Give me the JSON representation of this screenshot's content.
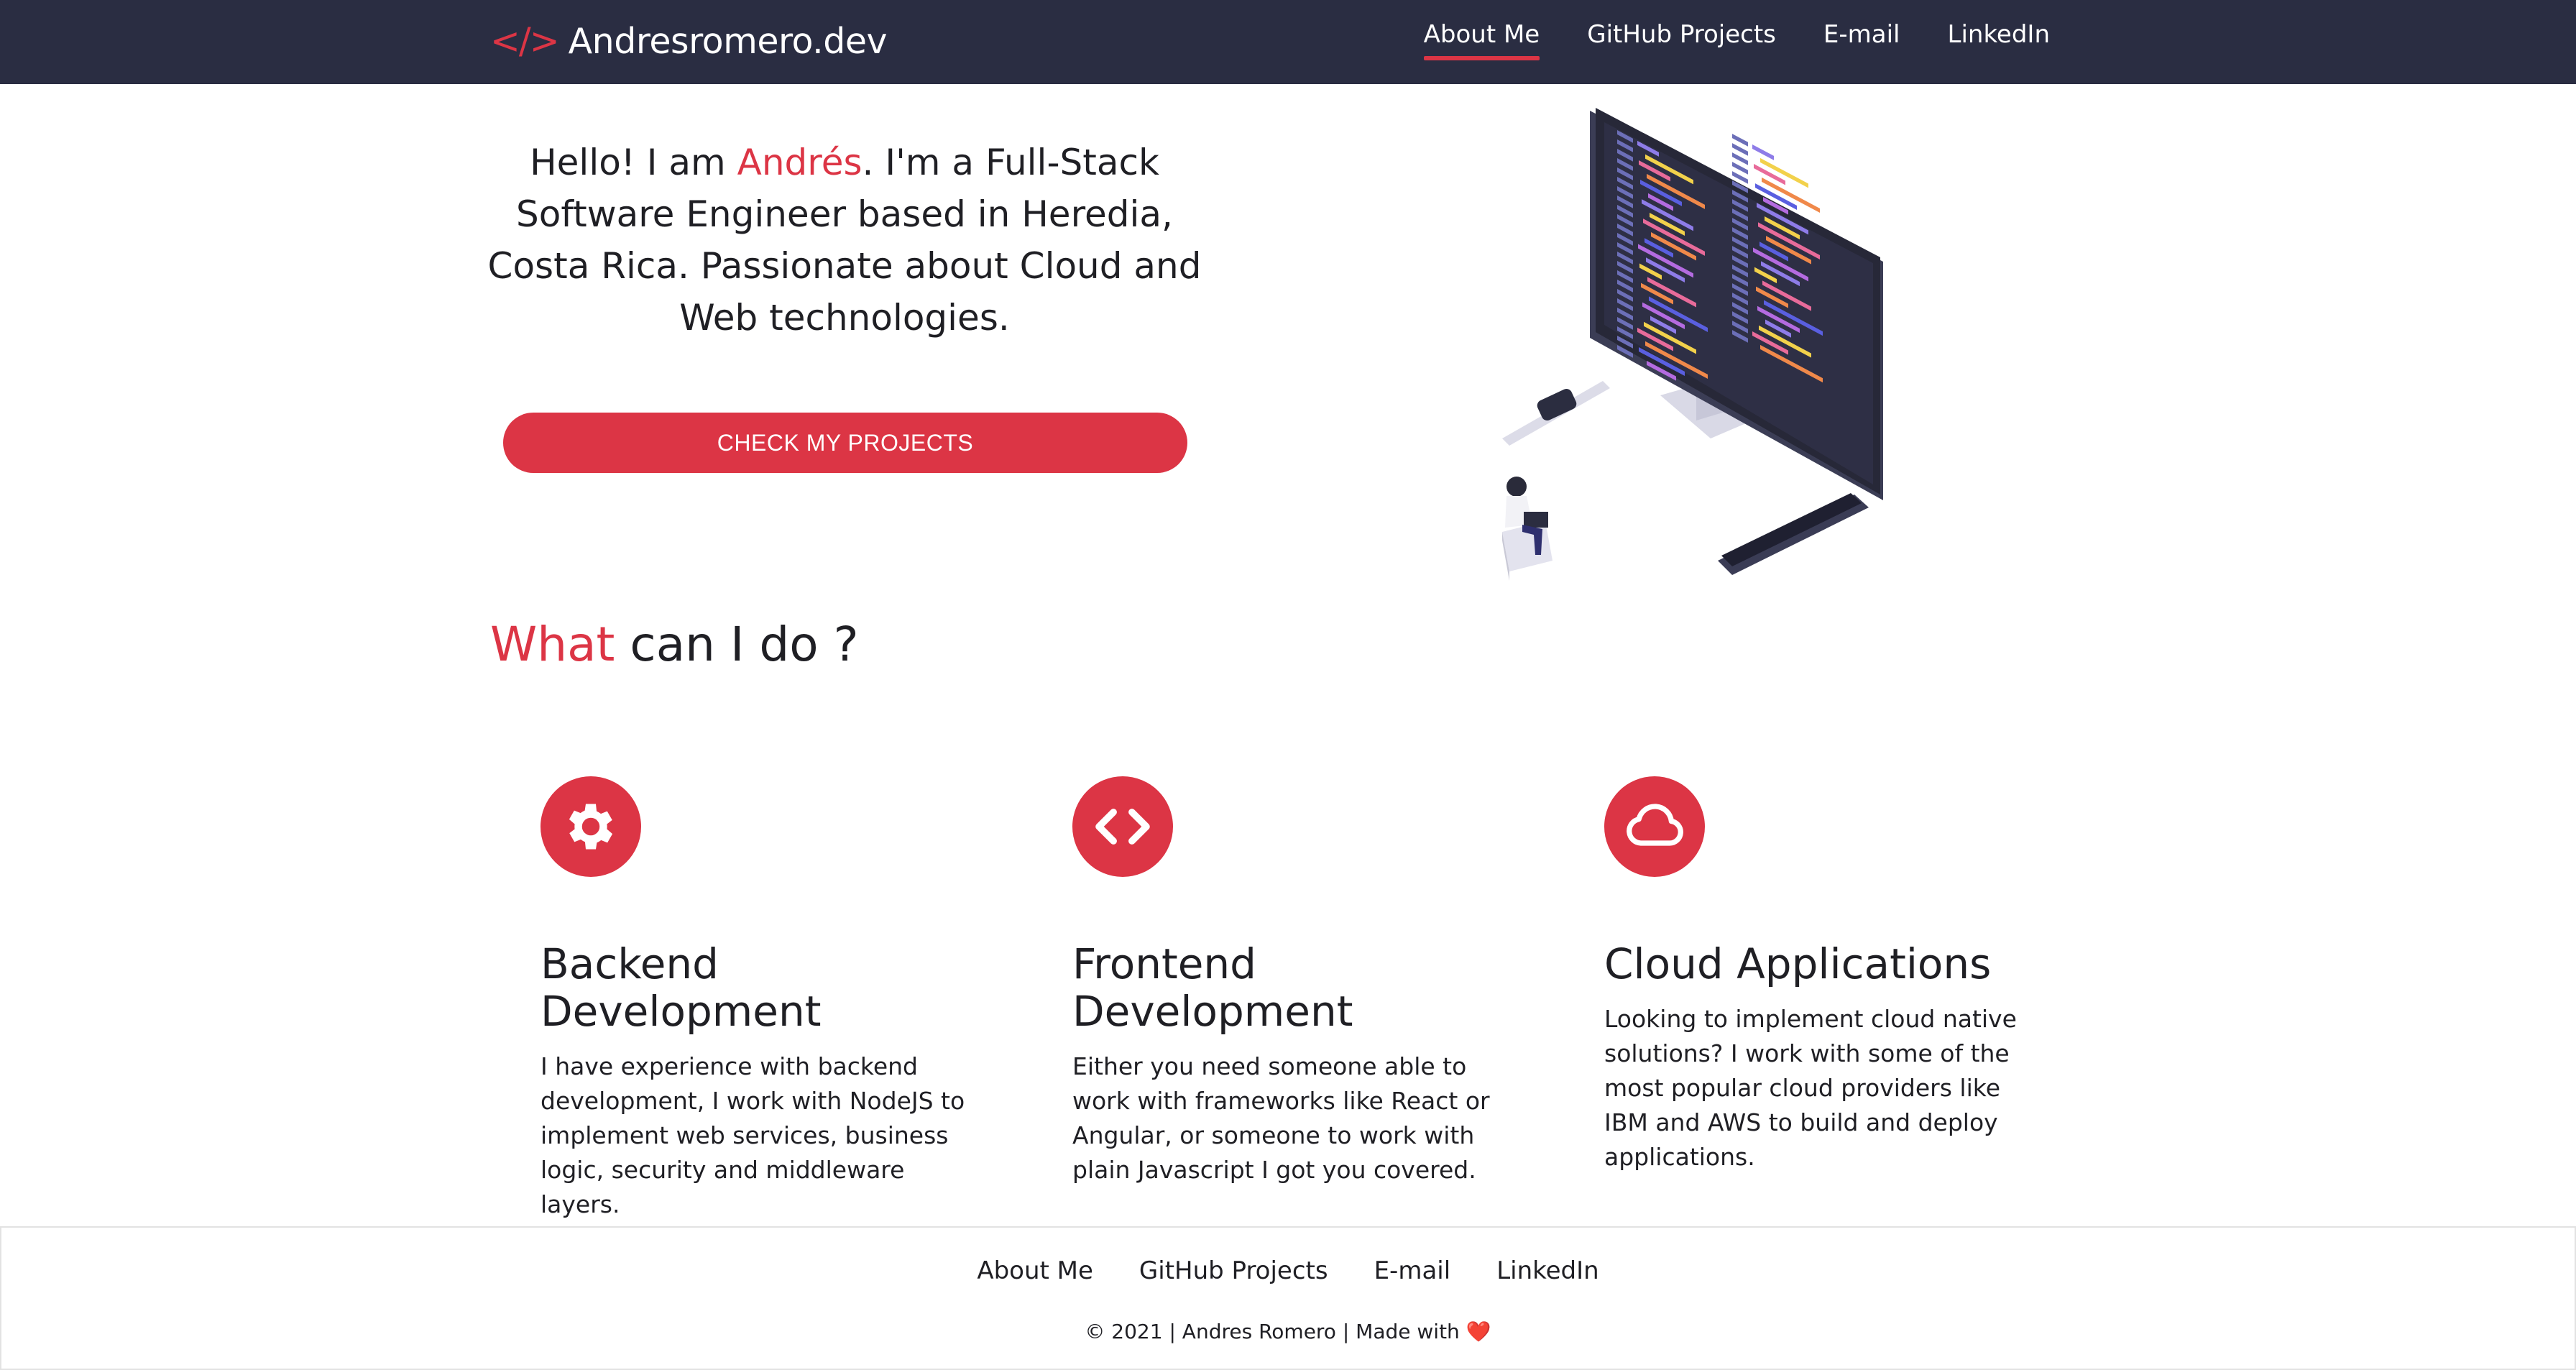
{
  "navbar": {
    "brand_icon": "</>",
    "brand_name": "Andresromero.dev",
    "links": [
      {
        "label": "About Me",
        "active": true
      },
      {
        "label": "GitHub Projects",
        "active": false
      },
      {
        "label": "E-mail",
        "active": false
      },
      {
        "label": "LinkedIn",
        "active": false
      }
    ]
  },
  "hero": {
    "greeting_prefix": "Hello! I am ",
    "name": "Andrés",
    "greeting_suffix": ". I'm a Full-Stack Software Engineer based in Heredia, Costa Rica. Passionate about Cloud and Web technologies.",
    "cta_label": "CHECK MY PROJECTS",
    "illustration": "developer-workstation-illustration"
  },
  "services_section": {
    "title_accent": "What",
    "title_rest": " can I do ?",
    "items": [
      {
        "icon": "gear-icon",
        "title": "Backend Development",
        "description": "I have experience with backend development, I work with NodeJS to implement web services, business logic, security and middleware layers."
      },
      {
        "icon": "code-icon",
        "title": "Frontend Development",
        "description": "Either you need someone able to work with frameworks like React or Angular, or someone to work with plain Javascript I got you covered."
      },
      {
        "icon": "cloud-icon",
        "title": "Cloud Applications",
        "description": "Looking to implement cloud native solutions? I work with some of the most popular cloud providers like IBM and AWS to build and deploy applications."
      }
    ]
  },
  "footer": {
    "links": [
      "About Me",
      "GitHub Projects",
      "E-mail",
      "LinkedIn"
    ],
    "copyright": "© 2021 | Andres Romero | Made with",
    "heart": "❤️"
  },
  "colors": {
    "accent": "#dc3545",
    "navbar_bg": "#2a2d42",
    "text": "#1f1f24"
  }
}
